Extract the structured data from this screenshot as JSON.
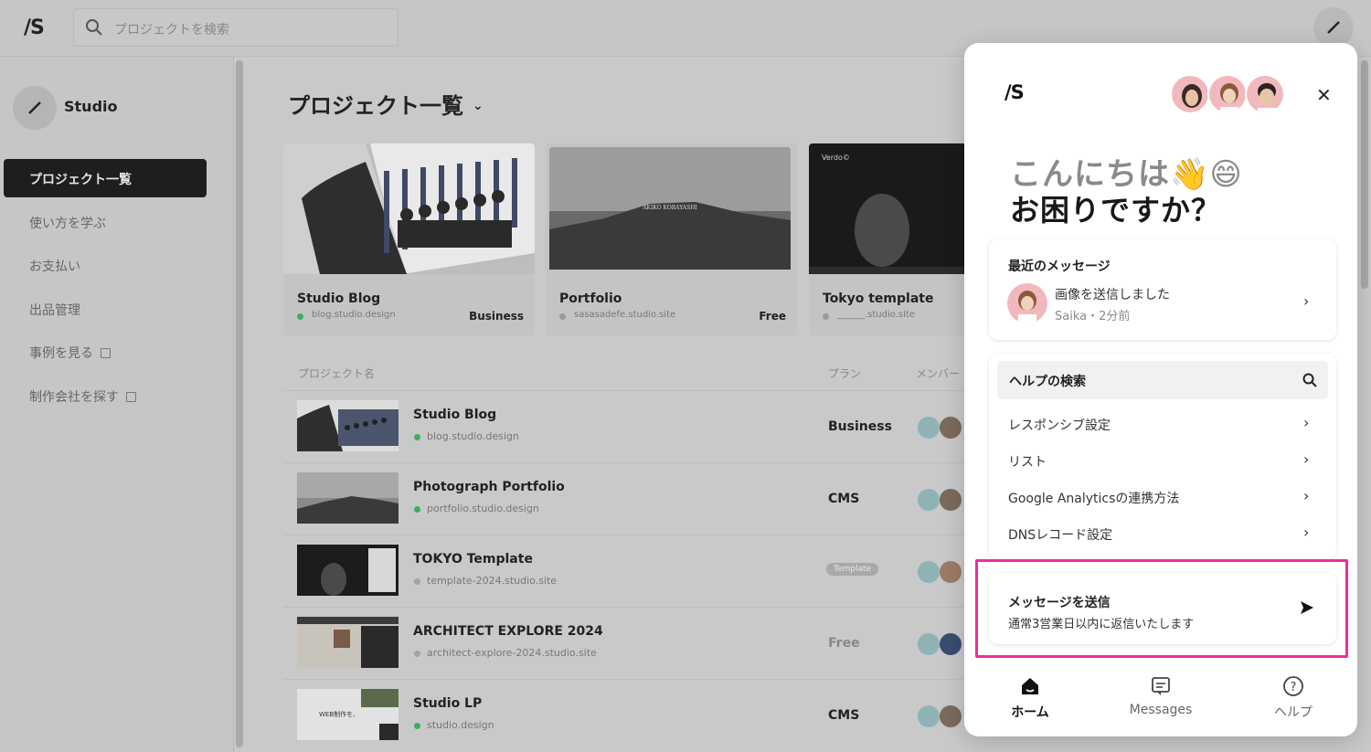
{
  "app": {
    "logo": "/S",
    "search_placeholder": "プロジェクトを検索"
  },
  "sidebar": {
    "workspace_name": "Studio",
    "items": [
      {
        "label": "プロジェクト一覧",
        "active": true
      },
      {
        "label": "使い方を学ぶ"
      },
      {
        "label": "お支払い"
      },
      {
        "label": "出品管理"
      },
      {
        "label": "事例を見る",
        "external": true
      },
      {
        "label": "制作会社を探す",
        "external": true
      }
    ]
  },
  "main": {
    "title": "プロジェクト一覧",
    "cards": [
      {
        "name": "Studio Blog",
        "url": "blog.studio.design",
        "plan": "Business",
        "status": "green"
      },
      {
        "name": "Portfolio",
        "url": "sasasadefe.studio.site",
        "plan": "Free",
        "status": "grey"
      },
      {
        "name": "Tokyo template",
        "url": "______.studio.site",
        "plan": "",
        "status": "grey"
      }
    ],
    "table": {
      "headers": [
        "プロジェクト名",
        "プラン",
        "メンバー"
      ],
      "rows": [
        {
          "name": "Studio Blog",
          "url": "blog.studio.design",
          "plan": "Business"
        },
        {
          "name": "Photograph Portfolio",
          "url": "portfolio.studio.design",
          "plan": "CMS"
        },
        {
          "name": "TOKYO Template",
          "url": "template-2024.studio.site",
          "plan": "Template"
        },
        {
          "name": "ARCHITECT EXPLORE 2024",
          "url": "architect-explore-2024.studio.site",
          "plan": "Free"
        },
        {
          "name": "Studio LP",
          "url": "studio.design",
          "plan": "CMS"
        }
      ]
    }
  },
  "widget": {
    "logo": "/S",
    "greeting_line1": "こんにちは👋😄",
    "greeting_line2": "お困りですか？",
    "recent": {
      "title": "最近のメッセージ",
      "message": "画像を送信しました",
      "meta": "Saika・2分前"
    },
    "help": {
      "search_label": "ヘルプの検索",
      "items": [
        "レスポンシブ設定",
        "リスト",
        "Google Analyticsの連携方法",
        "DNSレコード設定"
      ]
    },
    "send": {
      "title": "メッセージを送信",
      "subtitle": "通常3営業日以内に返信いたします"
    },
    "tabs": [
      {
        "label": "ホーム",
        "active": true
      },
      {
        "label": "Messages"
      },
      {
        "label": "ヘルプ"
      }
    ],
    "highlight_color": "#ef2c9c"
  }
}
